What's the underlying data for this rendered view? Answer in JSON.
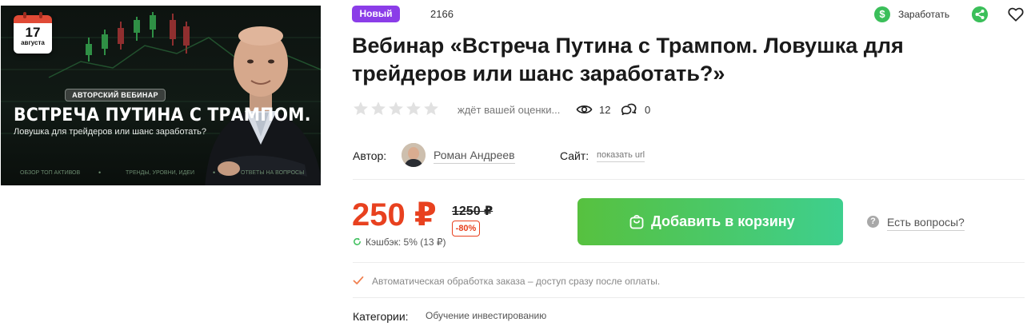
{
  "banner": {
    "calendar_day": "17",
    "calendar_month": "августа",
    "badge": "АВТОРСКИЙ ВЕБИНАР",
    "title": "ВСТРЕЧА ПУТИНА С ТРАМПОМ.",
    "subtitle": "Ловушка для трейдеров или шанс заработать?",
    "footer_items": [
      "ОБЗОР ТОП АКТИВОВ",
      "ТРЕНДЫ, УРОВНИ, ИДЕИ",
      "ОТВЕТЫ НА ВОПРОСЫ"
    ]
  },
  "badge_new": "Новый",
  "product_id": "2166",
  "header_actions": {
    "earn_icon_glyph": "$",
    "earn_label": "Заработать",
    "share_icon": "share-icon",
    "favorite_icon": "heart-icon"
  },
  "title": "Вебинар «Встреча Путина с Трампом. Ловушка для трейдеров или шанс заработать?»",
  "rating": {
    "stars_total": 5,
    "stars_filled": 0,
    "text": "ждёт вашей оценки...",
    "views": "12",
    "comments": "0"
  },
  "author": {
    "label": "Автор:",
    "name": "Роман Андреев"
  },
  "site": {
    "label": "Сайт:",
    "link": "показать url"
  },
  "price": {
    "current": "250 ₽",
    "old": "1250 ₽",
    "discount": "-80%",
    "cashback": "Кэшбэк: 5% (13 ₽)"
  },
  "cart_button": "Добавить в корзину",
  "questions": {
    "icon_glyph": "?",
    "label": "Есть вопросы?"
  },
  "auto_processing": "Автоматическая обработка заказа – доступ сразу после оплаты.",
  "categories": {
    "label": "Категории:",
    "value": "Обучение инвестированию"
  },
  "colors": {
    "badge_new": "#8b3de8",
    "price": "#e8411f",
    "cart_button_start": "#57c13f",
    "cart_button_end": "#3ecf8e",
    "green_icon": "#3bbf5a",
    "banner_bg": "#0d1310"
  }
}
